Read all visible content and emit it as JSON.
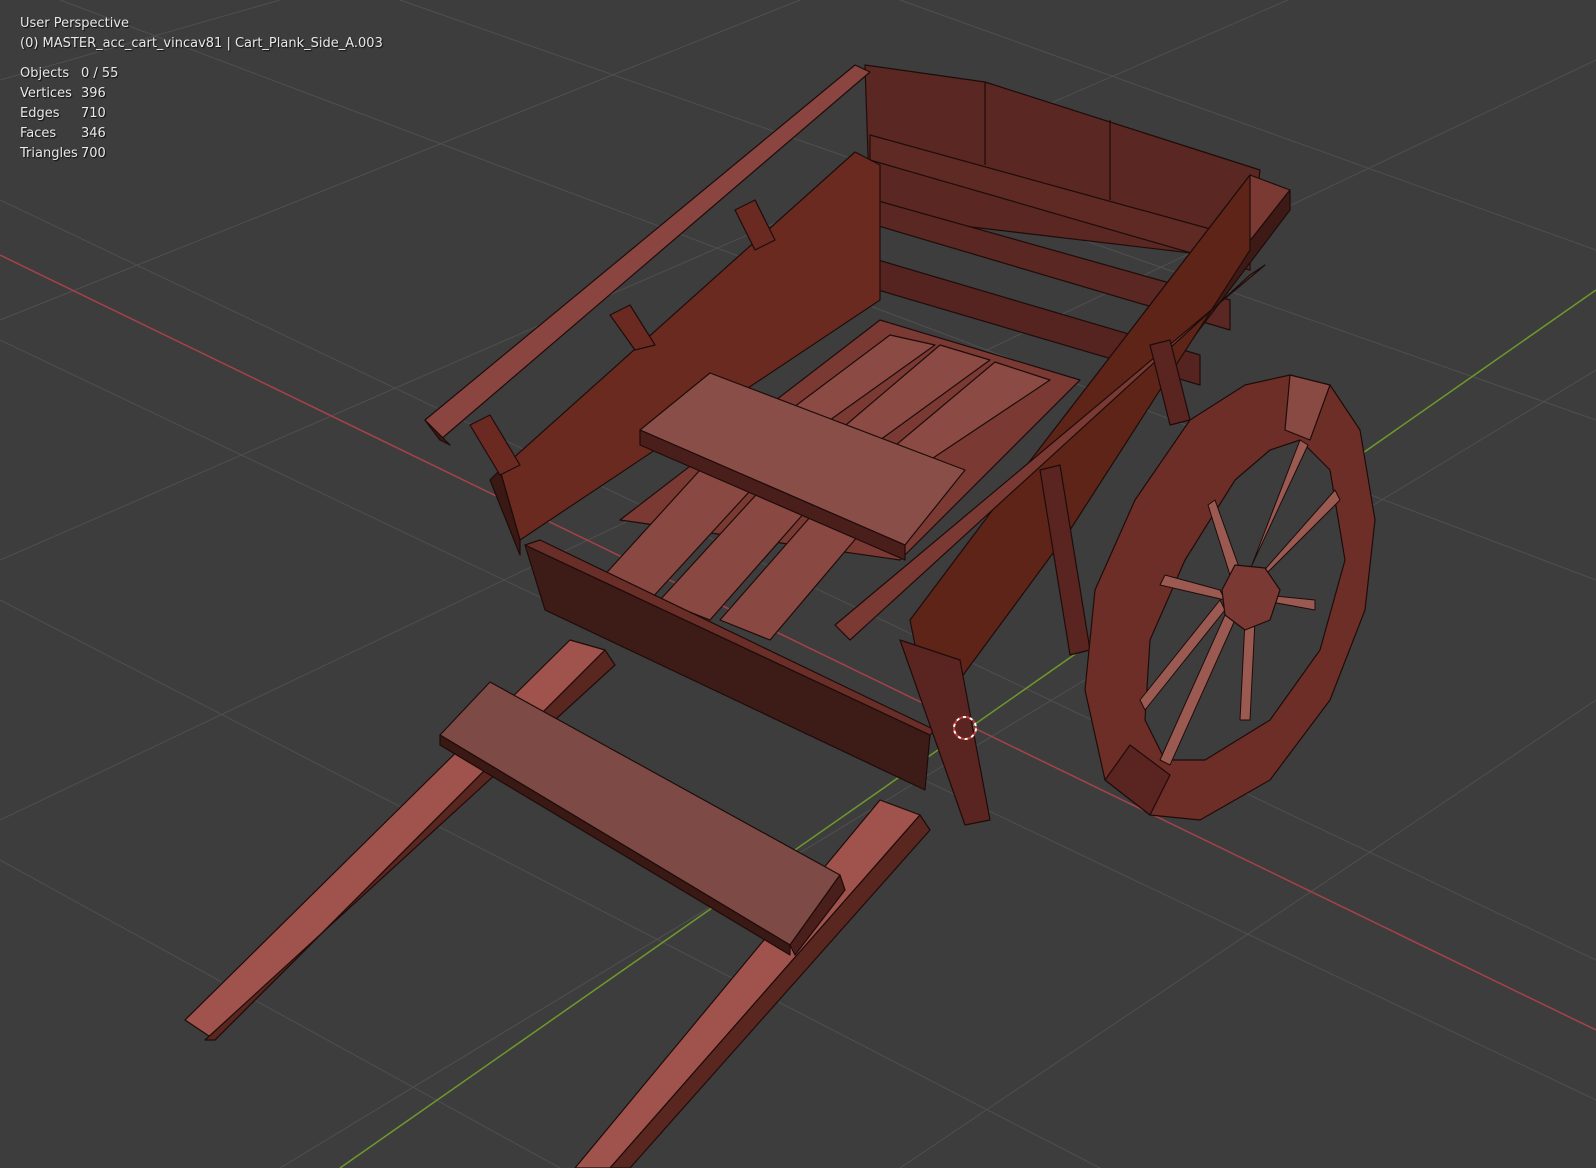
{
  "viewport": {
    "view_name": "User Perspective",
    "context": "(0) MASTER_acc_cart_vincav81 | Cart_Plank_Side_A.003",
    "stats": [
      {
        "label": "Objects",
        "value": "0 / 55"
      },
      {
        "label": "Vertices",
        "value": "396"
      },
      {
        "label": "Edges",
        "value": "710"
      },
      {
        "label": "Faces",
        "value": "346"
      },
      {
        "label": "Triangles",
        "value": "700"
      }
    ]
  },
  "colors": {
    "background": "#3d3d3d",
    "grid": "#4f4f4f",
    "x_axis": "#a5424a",
    "y_axis": "#6e9a2a",
    "model_base": "#7a3a33",
    "model_dark": "#3a1c18",
    "model_light": "#8a4e49",
    "cursor": "#c83a3a"
  },
  "icons": {
    "cursor": "3d-cursor-icon"
  }
}
